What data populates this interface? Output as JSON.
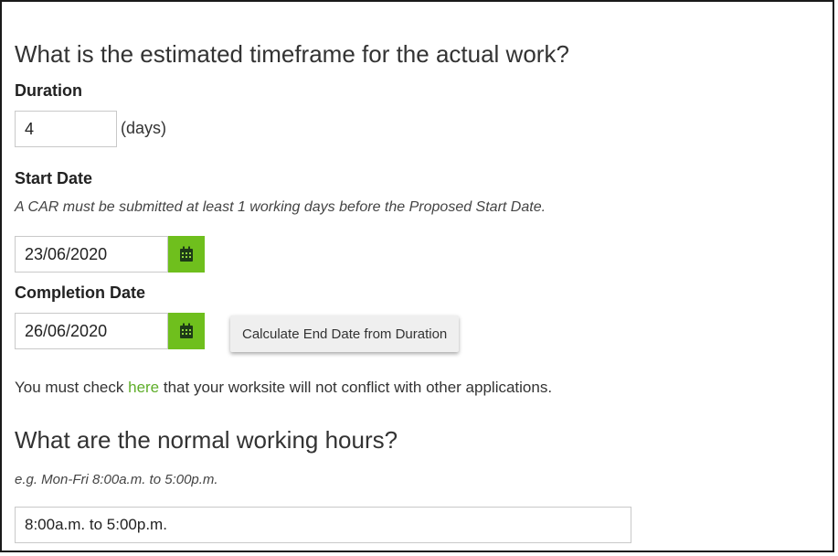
{
  "timeframe": {
    "heading": "What is the estimated timeframe for the actual work?",
    "duration": {
      "label": "Duration",
      "value": "4",
      "unit": "(days)"
    },
    "start_date": {
      "label": "Start Date",
      "note": "A CAR must be submitted at least 1 working days before the Proposed Start Date.",
      "value": "23/06/2020",
      "icon": "calendar-icon"
    },
    "completion_date": {
      "label": "Completion Date",
      "value": "26/06/2020",
      "icon": "calendar-icon"
    },
    "calculate_button_label": "Calculate End Date from Duration",
    "conflict_check": {
      "before": "You must check ",
      "link_text": "here",
      "after": " that your worksite will not conflict with other applications."
    }
  },
  "working_hours": {
    "heading": "What are the normal working hours?",
    "hint": "e.g. Mon-Fri 8:00a.m. to 5:00p.m.",
    "value": "8:00a.m. to 5:00p.m."
  },
  "colors": {
    "accent_green": "#6fbf1d",
    "link_green": "#5fae2a",
    "frame_border": "#1a1a1a"
  }
}
